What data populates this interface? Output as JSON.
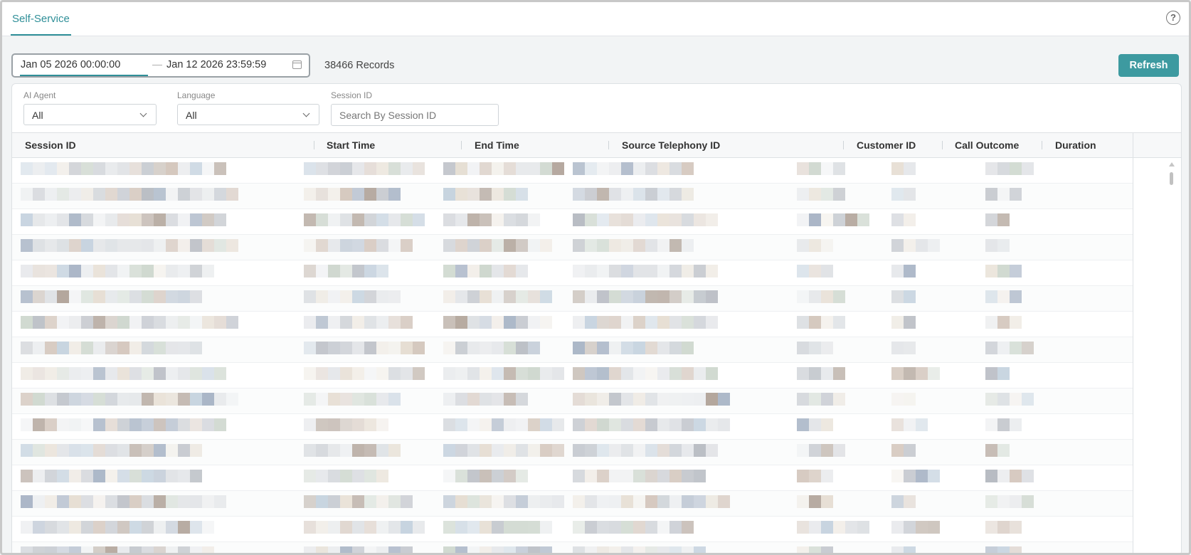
{
  "tabs": [
    {
      "label": "Self-Service",
      "active": true
    }
  ],
  "help_icon": "?",
  "date_range": {
    "start": "Jan 05 2026 00:00:00",
    "separator": "—",
    "end": "Jan 12 2026 23:59:59"
  },
  "records_label": "38466 Records",
  "refresh_label": "Refresh",
  "filters": {
    "ai_agent": {
      "label": "AI Agent",
      "value": "All"
    },
    "language": {
      "label": "Language",
      "value": "All"
    },
    "session_id": {
      "label": "Session ID",
      "placeholder": "Search By Session ID"
    }
  },
  "table": {
    "columns": [
      "Session ID",
      "Start Time",
      "End Time",
      "Source Telephony ID",
      "Customer ID",
      "Call Outcome",
      "Duration"
    ],
    "row_count_visible": 16,
    "rows_note": "cell contents are pixelated / redacted in the screenshot"
  },
  "colors": {
    "accent": "#2f8f98",
    "button": "#3d9aa0",
    "redaction_palette": [
      "#c9cdd3",
      "#d9dce0",
      "#e4e6e9",
      "#eceef0",
      "#b8bcc3",
      "#d4c7bd",
      "#c6d3df",
      "#e6ded3",
      "#a9b5c6",
      "#cfd8cf",
      "#f0ece6",
      "#b3a69c"
    ]
  }
}
